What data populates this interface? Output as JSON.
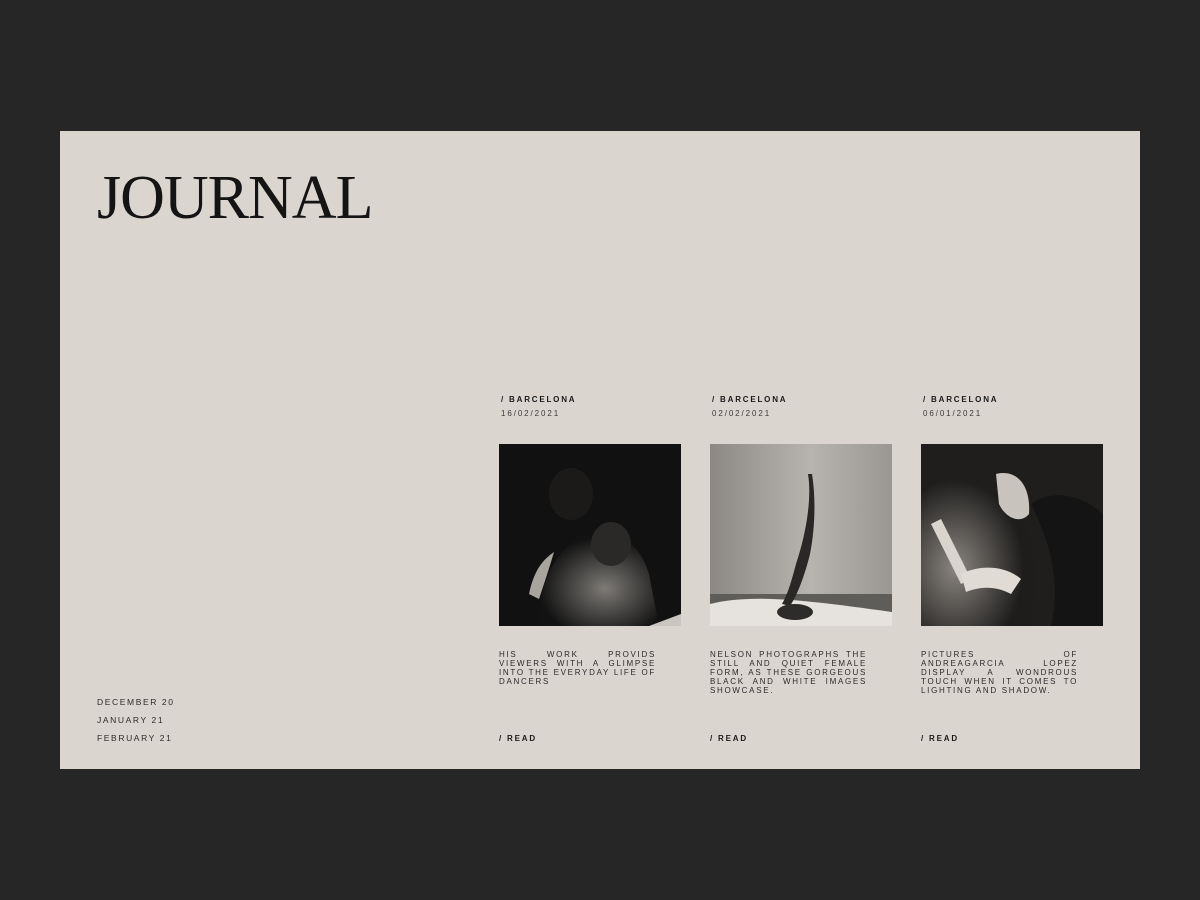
{
  "page": {
    "title": "JOURNAL",
    "background_color": "#262626",
    "panel_color": "#dbd5cf"
  },
  "archive": [
    "DECEMBER 20",
    "JANUARY 21",
    "FEBRUARY 21"
  ],
  "posts": [
    {
      "location": "/ BARCELONA",
      "date": "16/02/2021",
      "image": "woman-bare-shoulder-photo",
      "description": "HIS WORK PROVIDS VIEWERS WITH A GLIMPSE INTO THE EVERYDAY LIFE OF DANCERS",
      "read_label": "/ READ"
    },
    {
      "location": "/ BARCELONA",
      "date": "02/02/2021",
      "image": "dancer-legs-up-wall-photo",
      "description": "NELSON PHOTOGRAPHS THE STILL AND QUIET FEMALE FORM, AS THESE GORGEOUS BLACK AND WHITE IMAGES SHOWCASE.",
      "read_label": "/ READ"
    },
    {
      "location": "/ BARCELONA",
      "date": "06/01/2021",
      "image": "woman-torso-shadow-photo",
      "description": "PICTURES OF ANDREAGARCIA LOPEZ DISPLAY A WONDROUS TOUCH WHEN IT COMES TO LIGHTING AND SHADOW.",
      "read_label": "/ READ"
    }
  ]
}
